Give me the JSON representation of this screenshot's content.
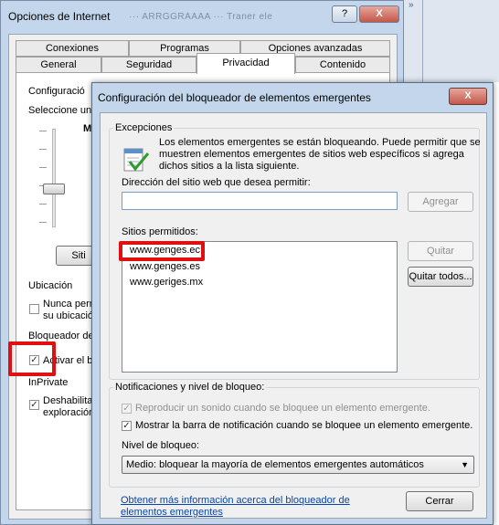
{
  "bg_window": {
    "title": "Opciones de Internet",
    "faded_text": "··· ARRGGRAAAA ··· Traner ele",
    "help_btn": "?",
    "close_btn": "X",
    "tabs_row1": [
      "Conexiones",
      "Programas",
      "Opciones avanzadas"
    ],
    "tabs_row2": [
      "General",
      "Seguridad",
      "Privacidad",
      "Contenido"
    ],
    "config_label": "Configuració",
    "select_label": "Seleccione una",
    "sites_btn": "Siti",
    "location_label": "Ubicación",
    "never_allow": "Nunca perm",
    "your_location": "su ubicació",
    "blocker_label": "Bloqueador de",
    "enable_blocker": "Activar el b",
    "inprivate_label": "InPrivate",
    "disable_toolbars": "Deshabilitar",
    "exploration": "exploración"
  },
  "dialog": {
    "title": "Configuración del bloqueador de elementos emergentes",
    "close_btn": "X",
    "exceptions_label": "Excepciones",
    "exceptions_text_1": "Los elementos emergentes se están bloqueando. Puede permitir que se",
    "exceptions_text_2": "muestren elementos emergentes de sitios web específicos si agrega",
    "exceptions_text_3": "dichos sitios a la lista siguiente.",
    "address_label": "Dirección del sitio web que desea permitir:",
    "address_value": "",
    "add_btn": "Agregar",
    "allowed_label": "Sitios permitidos:",
    "allowed_sites": [
      "www.genges.ec",
      "www.genges.es",
      "www.geriges.mx"
    ],
    "remove_btn": "Quitar",
    "remove_all_btn": "Quitar todos...",
    "notifications_label": "Notificaciones y nivel de bloqueo:",
    "play_sound": "Reproducir un sonido cuando se bloquee un elemento emergente.",
    "show_bar": "Mostrar la barra de notificación cuando se bloquee un elemento emergente.",
    "level_label": "Nivel de bloqueo:",
    "level_value": "Medio: bloquear la mayoría de elementos emergentes automáticos",
    "more_info_link_1": "Obtener más información acerca del bloqueador de",
    "more_info_link_2": "elementos emergentes",
    "close_btn_label": "Cerrar"
  },
  "colors": {
    "highlight": "#e01010",
    "window_frame": "#c3d6ec",
    "link": "#0645ad"
  }
}
